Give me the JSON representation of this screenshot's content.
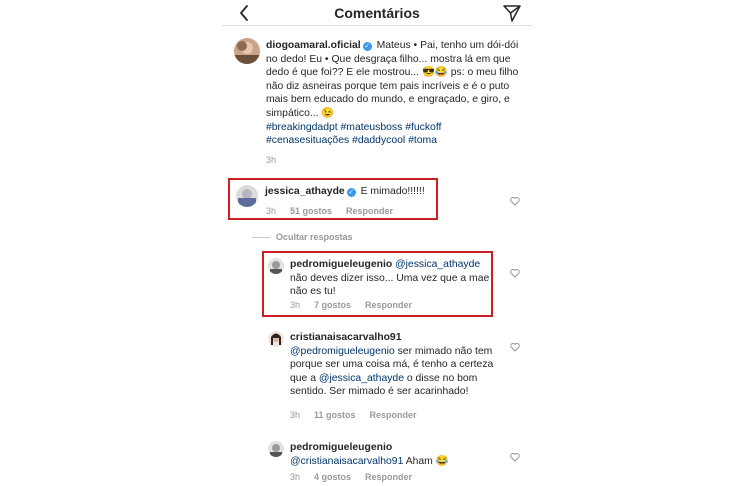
{
  "header": {
    "title": "Comentários"
  },
  "post": {
    "username": "diogoamaral.oficial",
    "text": "Mateus • Pai, tenho um dói-dói no dedo! Eu • Que desgraça filho... mostra lá em que dedo é que foi?? E ele mostrou... 😎😂 ps: o meu filho não diz asneiras porque tem pais incríveis e é o puto mais bem educado do mundo, e engraçado, e giro, e simpático... 😉",
    "hashtags": "#breakingdadpt #mateusboss #fuckoff #cenasesituações #daddycool #toma",
    "time": "3h"
  },
  "comments": [
    {
      "username": "jessica_athayde",
      "text": "E mimado!!!!!!",
      "time": "3h",
      "likes": "51 gostos",
      "reply": "Responder"
    }
  ],
  "hide_replies": "Ocultar respostas",
  "replies": [
    {
      "username": "pedromigueleugenio",
      "mention": "@jessica_athayde",
      "text": "não deves dizer isso... Uma vez que a mae não es tu!",
      "time": "3h",
      "likes": "7 gostos",
      "reply": "Responder"
    },
    {
      "username": "cristianaisacarvalho91",
      "mention": "@pedromigueleugenio",
      "text": "ser mimado não tem porque ser uma coisa má, é tenho a certeza que a",
      "mention2": "@jessica_athayde",
      "text2": "o disse no bom sentido. Ser mimado é ser acarinhado!",
      "time": "3h",
      "likes": "11 gostos",
      "reply": "Responder"
    },
    {
      "username": "pedromigueleugenio",
      "mention": "@cristianaisacarvalho91",
      "text": "Aham 😂",
      "time": "3h",
      "likes": "4 gostos",
      "reply": "Responder"
    }
  ],
  "colors": {
    "highlight": "#cc1f1f",
    "link": "#003569",
    "verified": "#3897f0",
    "meta": "#999999"
  },
  "icons": [
    "back-arrow-icon",
    "direct-send-icon",
    "verified-badge-icon",
    "heart-icon"
  ]
}
